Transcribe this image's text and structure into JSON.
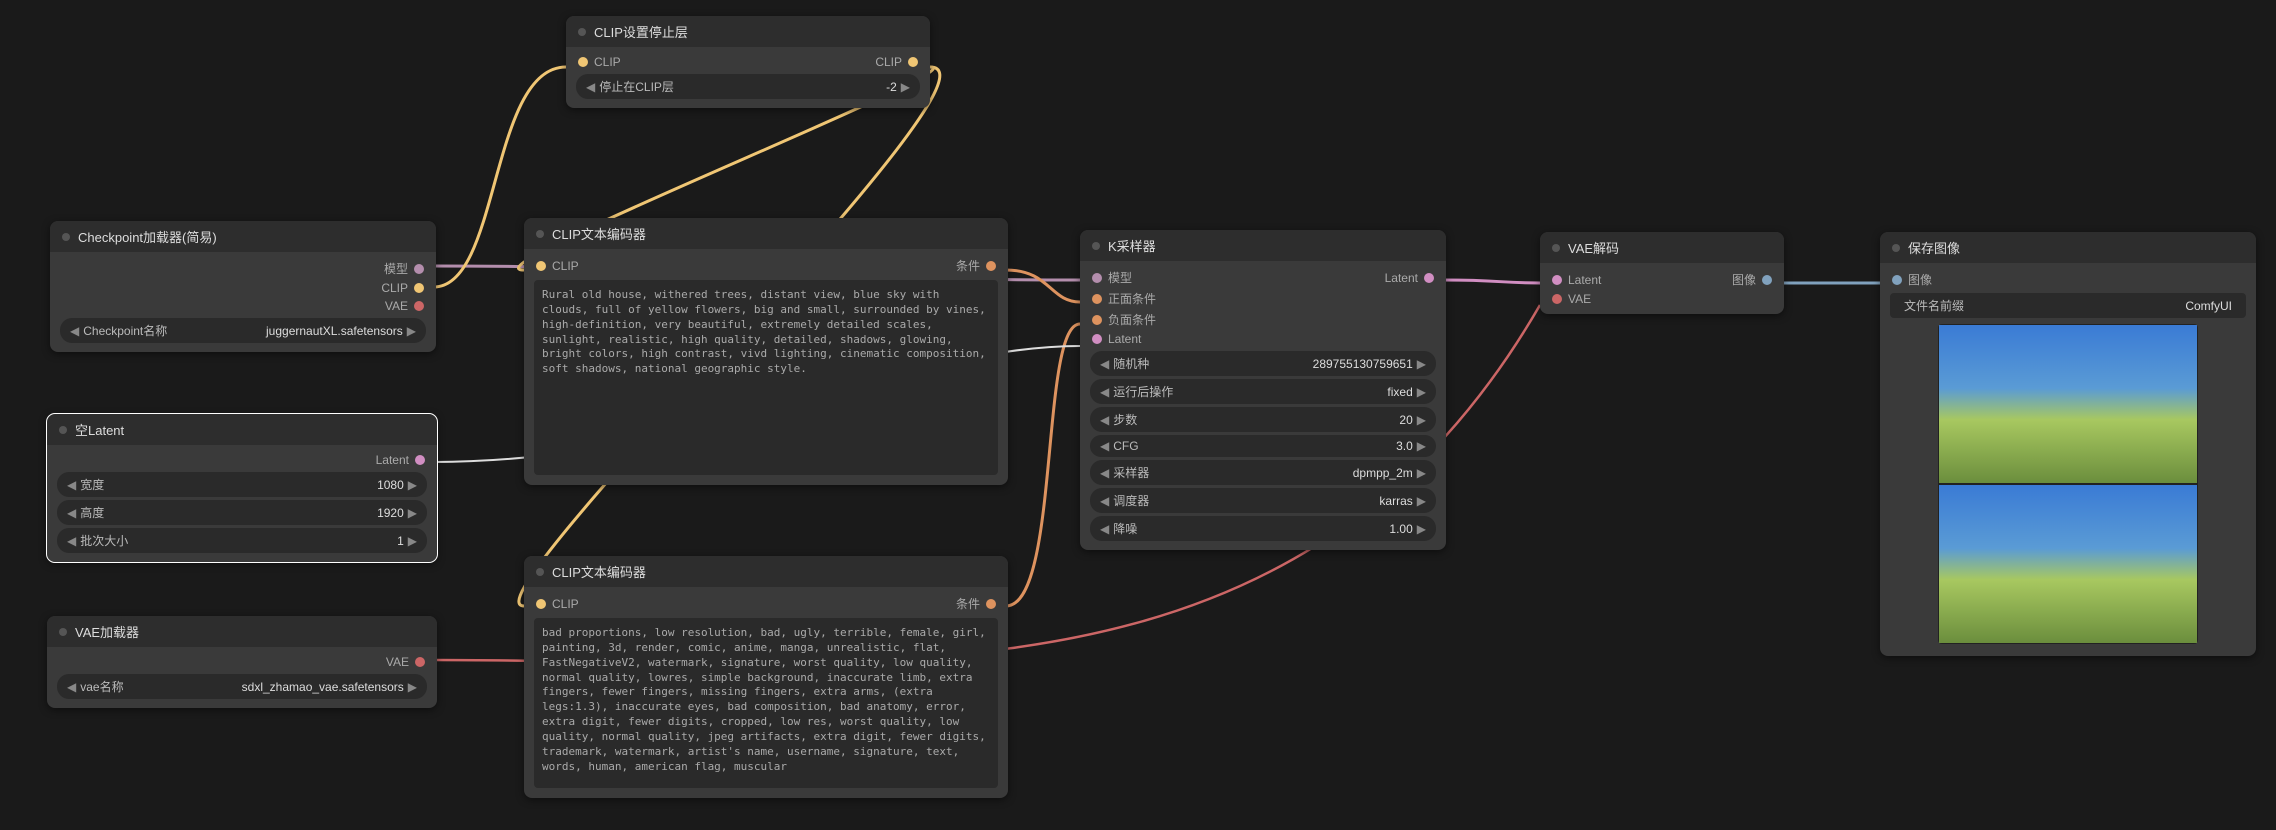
{
  "nodes": {
    "checkpoint": {
      "title": "Checkpoint加载器(简易)",
      "outputs": [
        "模型",
        "CLIP",
        "VAE"
      ],
      "widget_label": "Checkpoint名称",
      "widget_value": "juggernautXL.safetensors"
    },
    "clipstop": {
      "title": "CLIP设置停止层",
      "input": "CLIP",
      "output": "CLIP",
      "widget_label": "停止在CLIP层",
      "widget_value": "-2"
    },
    "clippos": {
      "title": "CLIP文本编码器",
      "input": "CLIP",
      "output": "条件",
      "text": "Rural old house, withered trees, distant view, blue sky with clouds, full of yellow flowers, big and small, surrounded by vines, high-definition, very beautiful, extremely detailed scales, sunlight, realistic, high quality, detailed, shadows, glowing, bright colors, high contrast, vivd lighting, cinematic composition, soft shadows, national geographic style."
    },
    "clipneg": {
      "title": "CLIP文本编码器",
      "input": "CLIP",
      "output": "条件",
      "text": "bad proportions, low resolution, bad, ugly, terrible, female, girl, painting, 3d, render, comic, anime, manga, unrealistic, flat, FastNegativeV2, watermark, signature, worst quality, low quality, normal quality, lowres, simple background, inaccurate limb, extra fingers, fewer fingers, missing fingers, extra arms, (extra legs:1.3), inaccurate eyes, bad composition, bad anatomy, error, extra digit, fewer digits, cropped, low res, worst quality, low quality, normal quality, jpeg artifacts, extra digit, fewer digits, trademark, watermark, artist's name, username, signature, text, words, human, american flag, muscular"
    },
    "emptylatent": {
      "title": "空Latent",
      "output": "Latent",
      "width_label": "宽度",
      "width_value": "1080",
      "height_label": "高度",
      "height_value": "1920",
      "batch_label": "批次大小",
      "batch_value": "1"
    },
    "vaeloader": {
      "title": "VAE加载器",
      "output": "VAE",
      "widget_label": "vae名称",
      "widget_value": "sdxl_zhamao_vae.safetensors"
    },
    "ksampler": {
      "title": "K采样器",
      "inputs": [
        "模型",
        "正面条件",
        "负面条件",
        "Latent"
      ],
      "output": "Latent",
      "seed_label": "随机种",
      "seed_value": "289755130759651",
      "after_label": "运行后操作",
      "after_value": "fixed",
      "steps_label": "步数",
      "steps_value": "20",
      "cfg_label": "CFG",
      "cfg_value": "3.0",
      "sampler_label": "采样器",
      "sampler_value": "dpmpp_2m",
      "scheduler_label": "调度器",
      "scheduler_value": "karras",
      "denoise_label": "降噪",
      "denoise_value": "1.00"
    },
    "vaedecode": {
      "title": "VAE解码",
      "inputs": [
        "Latent",
        "VAE"
      ],
      "output": "图像"
    },
    "saveimage": {
      "title": "保存图像",
      "input": "图像",
      "prefix_label": "文件名前缀",
      "prefix_value": "ComfyUI"
    }
  }
}
